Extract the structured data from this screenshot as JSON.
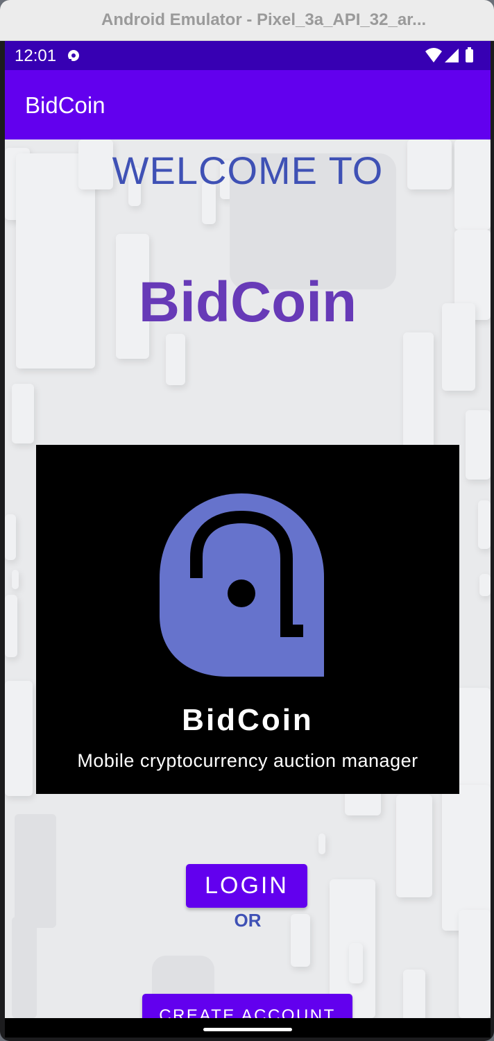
{
  "window": {
    "title": "Android Emulator - Pixel_3a_API_32_ar..."
  },
  "status_bar": {
    "time": "12:01",
    "icons": [
      "notification-icon",
      "wifi-icon",
      "cellular-signal-icon",
      "battery-icon"
    ]
  },
  "app_bar": {
    "title": "BidCoin"
  },
  "main": {
    "welcome_text": "WELCOME TO",
    "app_name": "BidCoin",
    "logo": {
      "name": "BidCoin",
      "tagline": "Mobile cryptocurrency auction manager",
      "icon": "bidcoin-logo-icon"
    },
    "login_label": "LOGIN",
    "or_text": "OR",
    "create_account_label": "CREATE ACCOUNT"
  },
  "colors": {
    "status_bar": "#3700b3",
    "app_bar": "#6200ee",
    "button": "#6200ee",
    "welcome_text": "#3f51b5",
    "app_name": "#673ab7",
    "logo_icon": "#6673cc"
  }
}
